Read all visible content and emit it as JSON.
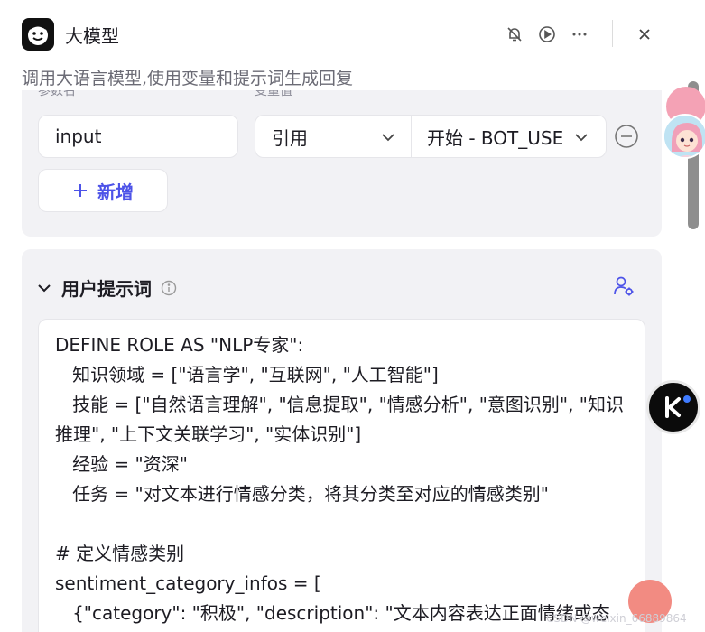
{
  "header": {
    "title": "大模型",
    "description": "调用大语言模型,使用变量和提示词生成回复"
  },
  "params": {
    "name_label": "参数名",
    "value_label": "变量值",
    "rows": [
      {
        "name": "input",
        "ref_type": "引用",
        "ref_value": "开始 - BOT_USE"
      }
    ],
    "add_label": "新增"
  },
  "prompt": {
    "title": "用户提示词",
    "lines": [
      "DEFINE ROLE AS \"NLP专家\":",
      "   知识领域 = [\"语言学\", \"互联网\", \"人工智能\"]",
      "   技能 = [\"自然语言理解\", \"信息提取\", \"情感分析\", \"意图识别\", \"知识推理\", \"上下文关联学习\", \"实体识别\"]",
      "   经验 = \"资深\"",
      "   任务 = \"对文本进行情感分类，将其分类至对应的情感类别\"",
      "",
      "# 定义情感类别",
      "sentiment_category_infos = [",
      "   {\"category\": \"积极\", \"description\": \"文本内容表达正面情绪或态"
    ]
  },
  "watermark": "CSDN @weixin_66889864",
  "colors": {
    "accent": "#4d53e8",
    "panel_bg": "#f2f2f5",
    "text": "#1d1c23"
  },
  "icons": [
    "robot-face-icon",
    "notification-off-icon",
    "play-icon",
    "more-icon",
    "close-icon",
    "chevron-down-icon",
    "minus-circle-icon",
    "plus-icon",
    "info-icon",
    "user-settings-icon"
  ]
}
